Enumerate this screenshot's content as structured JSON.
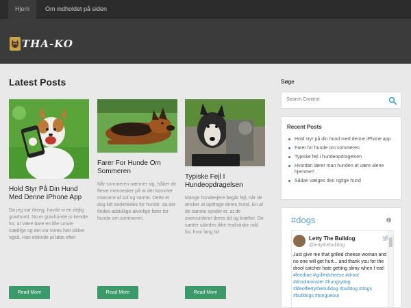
{
  "nav": {
    "items": [
      "Hjem",
      "Om indholdet på siden"
    ]
  },
  "header": {
    "logo_text": "THA-KO"
  },
  "main": {
    "title": "Latest Posts",
    "posts": [
      {
        "title": "Hold Styr På Din Hund Med Denne IPhone App",
        "excerpt": "Da jeg var dreng, havde vi en dejlig gravhund. Nu er gravhunde jo kendte for, at være bare en lille smule stædige og det var vores helt sikker også. Han elskede at løbe efter",
        "read_more": "Read More"
      },
      {
        "title": "Farer For Hunde Om Sommeren",
        "excerpt": "Når sommeren nærmer sig, håber de fleste mennesker på at der kommer massere af sol og varme. Dette er dog lidt anderledes for hunde, da der findes adskillige alvorlige farer for hunde om sommeren.",
        "read_more": "Read More"
      },
      {
        "title": "Typiske Fejl I Hundeopdragelsen",
        "excerpt": "Mange hundeejere begår fejl, når de ønsker at opdrage deres hund. En af de største synder er, at de overvurderer deres tid og kræfter. De sætter således ikke realistiske mål for, hvor lang tid",
        "read_more": "Read More"
      }
    ]
  },
  "sidebar": {
    "search_title": "Søge",
    "search_placeholder": "Search Content",
    "recent_title": "Recent Posts",
    "recent_posts": [
      "Hold styr på din hund med denne iPhone app",
      "Farer for hunde om sommeren",
      "Typiske fejl i hundeopdragelsen",
      "Hvordan lærer man hunden at være alene hjemme?",
      "Sådan vælges den rigtige hund"
    ],
    "twitter": {
      "hashtag": "#dogs",
      "name": "Letty The Bulldog",
      "handle": "@lettythebulldog",
      "text_plain": "Just give me that grilled cheese woman and no one will get hurt... and thank you for the drool catcher hate getting slimy when I eat! ",
      "hashtags": "#feedme #grilledcheese #drool #droolmonster #hungrydog #lifeofflettythebulldog #bulldog #dogs #bulldogs #tongueout"
    }
  },
  "colors": {
    "button": "#3c9a6a",
    "nav_bg": "#2c2c2c",
    "header_bg": "#3b3b3b",
    "page_bg": "#e9e9e9",
    "link_blue": "#3b88c3"
  }
}
